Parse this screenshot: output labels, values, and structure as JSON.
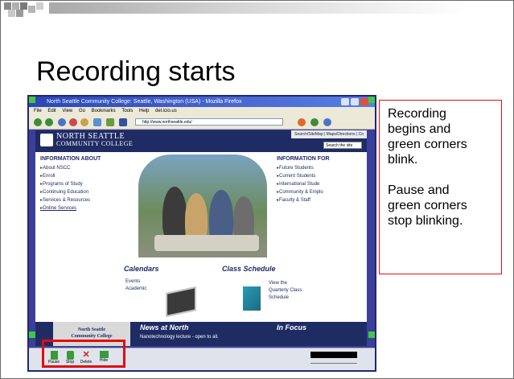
{
  "slide": {
    "title": "Recording starts",
    "note_lines_1": [
      "Recording",
      "begins and",
      "green corners",
      "blink."
    ],
    "note_lines_2": [
      "Pause and",
      "green corners",
      "stop blinking."
    ]
  },
  "browser": {
    "window_title": "North Seattle Community College: Seattle, Washington (USA) - Mozilla Firefox",
    "menu": [
      "File",
      "Edit",
      "View",
      "Go",
      "Bookmarks",
      "Tools",
      "Help",
      "del.icio.us"
    ],
    "url": "http://www.northseattle.edu/"
  },
  "site": {
    "logo_line1": "NORTH SEATTLE",
    "logo_line2": "COMMUNITY COLLEGE",
    "top_links": "Search/SiteMap  |  Maps/Directions  |  Co",
    "search_placeholder": "Search the site",
    "info_about_heading": "INFORMATION ABOUT",
    "info_about": [
      "About NSCC",
      "Enroll",
      "Programs of Study",
      "Continuing Education",
      "Services & Resources",
      "Online Services"
    ],
    "info_for_heading": "INFORMATION FOR",
    "info_for": [
      "Future Students",
      "Current Students",
      "International Stude",
      "Community & Emplo",
      "Faculty & Staff"
    ],
    "calendars_heading": "Calendars",
    "calendars_text": [
      "Events",
      "Academic"
    ],
    "schedule_heading": "Class Schedule",
    "schedule_text": [
      "View the",
      "Quarterly Class",
      "Schedule"
    ],
    "news_heading": "News at North",
    "focus_heading": "In Focus",
    "nscc_box": [
      "North Seattle",
      "Community College"
    ],
    "news_item": "Nanotechnology lecture - open to all."
  },
  "recorder": {
    "buttons": [
      {
        "label": "Pause",
        "icon": "pause-icon",
        "color": "#3a9a3a"
      },
      {
        "label": "Stop",
        "icon": "stop-icon",
        "color": "#3a9a3a"
      },
      {
        "label": "Delete",
        "icon": "delete-icon",
        "color": "#d42020"
      },
      {
        "label": "Hide",
        "icon": "hide-icon",
        "color": "#3a9a3a"
      }
    ]
  },
  "colors": {
    "highlight_red": "#e40b0b",
    "corner_green": "#41c941",
    "site_navy": "#1f2b63"
  }
}
